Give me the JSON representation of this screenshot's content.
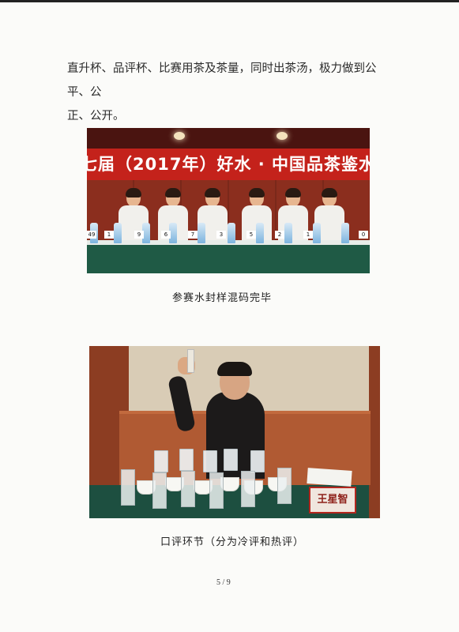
{
  "body_text": {
    "line1": "直升杯、品评杯、比赛用茶及茶量，同时出茶汤，极力做到公平、公",
    "line2": "正、公开。"
  },
  "photo1": {
    "banner_text": "七届（2017年）好水 · 中国品茶鉴水",
    "bottle_tags": [
      "49",
      "1",
      "9",
      "6",
      "7",
      "3",
      "5",
      "2",
      "1",
      "0"
    ],
    "banner_color": "#c4221b"
  },
  "caption1": "参赛水封样混码完毕",
  "photo2": {
    "nameplate": "王星智"
  },
  "caption2": "口评环节（分为冷评和热评）",
  "page_number": "5 / 9"
}
